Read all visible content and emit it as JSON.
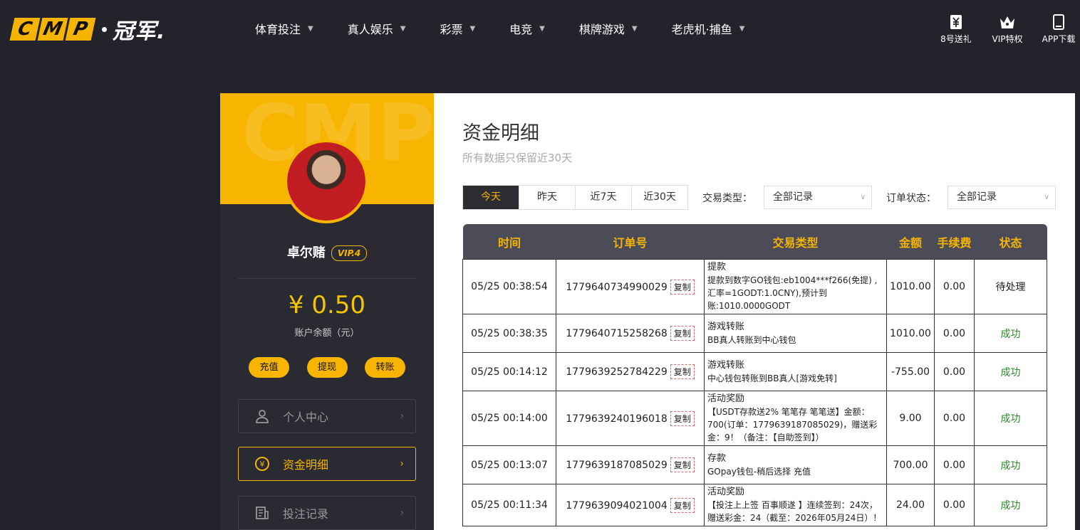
{
  "brand": {
    "logo_letters": [
      "C",
      "M",
      "P"
    ],
    "logo_cn": "冠军."
  },
  "nav": [
    {
      "label": "体育投注"
    },
    {
      "label": "真人娱乐"
    },
    {
      "label": "彩票"
    },
    {
      "label": "电竞"
    },
    {
      "label": "棋牌游戏"
    },
    {
      "label": "老虎机·捕鱼"
    }
  ],
  "right_icons": [
    {
      "label": "8号送礼",
      "icon": "gift-ticket-icon"
    },
    {
      "label": "VIP特权",
      "icon": "crown-icon"
    },
    {
      "label": "APP下载",
      "icon": "phone-icon"
    }
  ],
  "profile": {
    "banner_watermark": "CMP",
    "username": "卓尔赌",
    "vip": "VIP.4",
    "balance": "¥ 0.50",
    "balance_label": "账户余额（元）",
    "actions": [
      "充值",
      "提现",
      "转账"
    ]
  },
  "menu": [
    {
      "label": "个人中心",
      "icon": "user-icon",
      "active": false
    },
    {
      "label": "资金明细",
      "icon": "yen-icon",
      "active": true
    },
    {
      "label": "投注记录",
      "icon": "bet-record-icon",
      "active": false
    }
  ],
  "page": {
    "title": "资金明细",
    "subtitle": "所有数据只保留近30天",
    "tabs": [
      "今天",
      "昨天",
      "近7天",
      "近30天"
    ],
    "active_tab": "今天",
    "type_label": "交易类型：",
    "type_value": "全部记录",
    "status_label": "订单状态：",
    "status_value": "全部记录"
  },
  "table": {
    "headers": [
      "时间",
      "订单号",
      "交易类型",
      "金额",
      "手续费",
      "状态"
    ],
    "copy_label": "复制",
    "rows": [
      {
        "time": "05/25 00:38:54",
        "order": "1779640734990029",
        "type": "提款",
        "desc": "提款到数字GO钱包:eb1004***f266(免提) ,汇率=1GODT:1.0CNY),预计到账:1010.0000GODT",
        "amount": "1010.00",
        "fee": "0.00",
        "status": "待处理",
        "success": false
      },
      {
        "time": "05/25 00:38:35",
        "order": "1779640715258268",
        "type": "游戏转账",
        "desc": "BB真人转账到中心钱包",
        "amount": "1010.00",
        "fee": "0.00",
        "status": "成功",
        "success": true
      },
      {
        "time": "05/25 00:14:12",
        "order": "1779639252784229",
        "type": "游戏转账",
        "desc": "中心钱包转账到BB真人[游戏免转]",
        "amount": "-755.00",
        "fee": "0.00",
        "status": "成功",
        "success": true
      },
      {
        "time": "05/25 00:14:00",
        "order": "1779639240196018",
        "type": "活动奖励",
        "desc": "【USDT存款送2% 笔笔存 笔笔送】金额：700(订单：1779639187085029)，赠送彩金：9！（备注：【自助签到】）",
        "amount": "9.00",
        "fee": "0.00",
        "status": "成功",
        "success": true
      },
      {
        "time": "05/25 00:13:07",
        "order": "1779639187085029",
        "type": "存款",
        "desc": "GOpay钱包-稍后选择 充值",
        "amount": "700.00",
        "fee": "0.00",
        "status": "成功",
        "success": true
      },
      {
        "time": "05/25 00:11:34",
        "order": "1779639094021004",
        "type": "活动奖励",
        "desc": "【投注上上签 百事顺遂 】连续签到：24次，赠送彩金：24（截至：2026年05月24日）！",
        "amount": "24.00",
        "fee": "0.00",
        "status": "成功",
        "success": true
      }
    ]
  },
  "colors": {
    "accent": "#f5b400",
    "bg": "#23232b",
    "success": "#2b8a2b"
  }
}
